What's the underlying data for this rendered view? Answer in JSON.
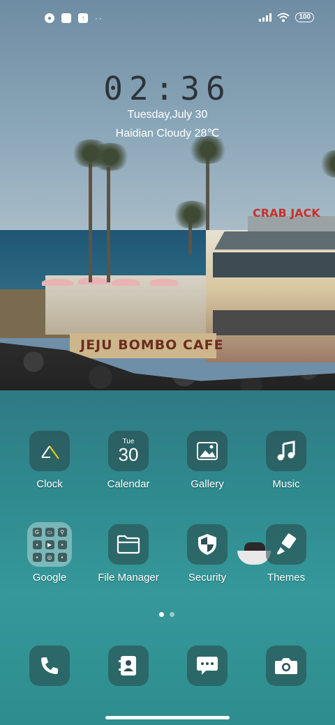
{
  "status_bar": {
    "icons_left": [
      "app-notification-icon",
      "square-notification-icon",
      "upload-icon",
      "more-dots-icon"
    ],
    "battery": "100"
  },
  "lock": {
    "time": "02:36",
    "date": "Tuesday,July 30",
    "weather": "Haidian Cloudy 28℃"
  },
  "wallpaper_text": {
    "sign": "CRAB JACK",
    "wall": "JEJU BOMBO CAFE"
  },
  "apps_row1": [
    {
      "label": "Clock",
      "icon": "clock-icon"
    },
    {
      "label": "Calendar",
      "icon": "calendar-icon",
      "day": "Tue",
      "date": "30"
    },
    {
      "label": "Gallery",
      "icon": "image-icon"
    },
    {
      "label": "Music",
      "icon": "music-note-icon"
    }
  ],
  "apps_row2": [
    {
      "label": "Google",
      "icon": "folder-icon",
      "folder_glyphs": [
        "G",
        "▭",
        "⚲",
        "▪",
        "▶",
        "▪",
        "▪",
        "◎",
        "▪"
      ]
    },
    {
      "label": "File Manager",
      "icon": "folder-open-icon"
    },
    {
      "label": "Security",
      "icon": "shield-icon"
    },
    {
      "label": "Themes",
      "icon": "paintbrush-icon"
    }
  ],
  "dock": [
    {
      "icon": "phone-icon"
    },
    {
      "icon": "contacts-icon"
    },
    {
      "icon": "messages-icon"
    },
    {
      "icon": "camera-icon"
    }
  ],
  "pager": {
    "pages": 2,
    "active": 1
  }
}
